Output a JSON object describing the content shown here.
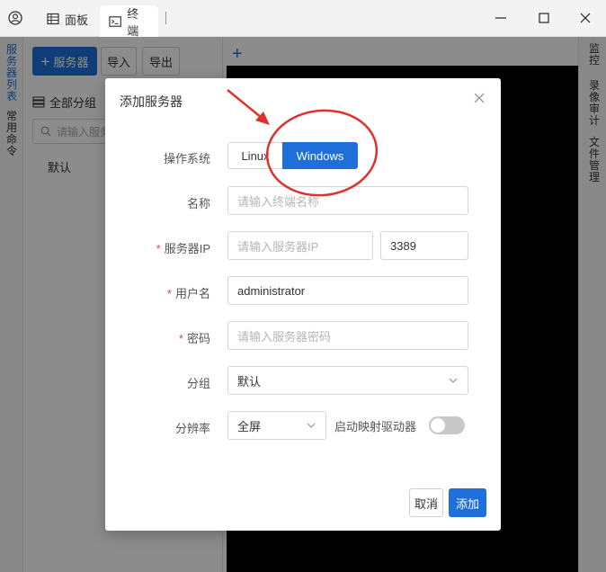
{
  "titlebar": {
    "tabs": [
      {
        "label": "面板",
        "icon": "table-icon"
      },
      {
        "label": "终端",
        "icon": "terminal-icon"
      }
    ],
    "window_controls": [
      "minimize-icon",
      "maximize-icon",
      "close-icon"
    ]
  },
  "left_rail": {
    "items": [
      {
        "label": "服务器列表",
        "active": true
      },
      {
        "label": "常用命令",
        "active": false
      }
    ]
  },
  "side_panel": {
    "add_server_label": "服务器",
    "import_label": "导入",
    "export_label": "导出",
    "group_header": "全部分组",
    "search_placeholder": "请输入服务",
    "tree_item": "默认"
  },
  "right_rail": {
    "items": [
      {
        "label": "监控"
      },
      {
        "label": "录像审计"
      },
      {
        "label": "文件管理"
      }
    ]
  },
  "dialog": {
    "title": "添加服务器",
    "os": {
      "label": "操作系统",
      "options": [
        "Linux",
        "Windows"
      ],
      "selected": "Windows"
    },
    "name": {
      "label": "名称",
      "placeholder": "请输入终端名称",
      "required": false
    },
    "server_ip": {
      "label": "服务器IP",
      "placeholder": "请输入服务器IP",
      "required": true
    },
    "port": {
      "value": "3389"
    },
    "username": {
      "label": "用户名",
      "value": "administrator",
      "required": true
    },
    "password": {
      "label": "密码",
      "placeholder": "请输入服务器密码",
      "required": true
    },
    "group": {
      "label": "分组",
      "value": "默认"
    },
    "resolution": {
      "label": "分辨率",
      "value": "全屏"
    },
    "map_drive": {
      "label": "启动映射驱动器",
      "enabled": false
    },
    "cancel_label": "取消",
    "confirm_label": "添加"
  },
  "colors": {
    "accent": "#1e6fd9",
    "required": "#e0473e",
    "annotation": "#e0302b"
  }
}
